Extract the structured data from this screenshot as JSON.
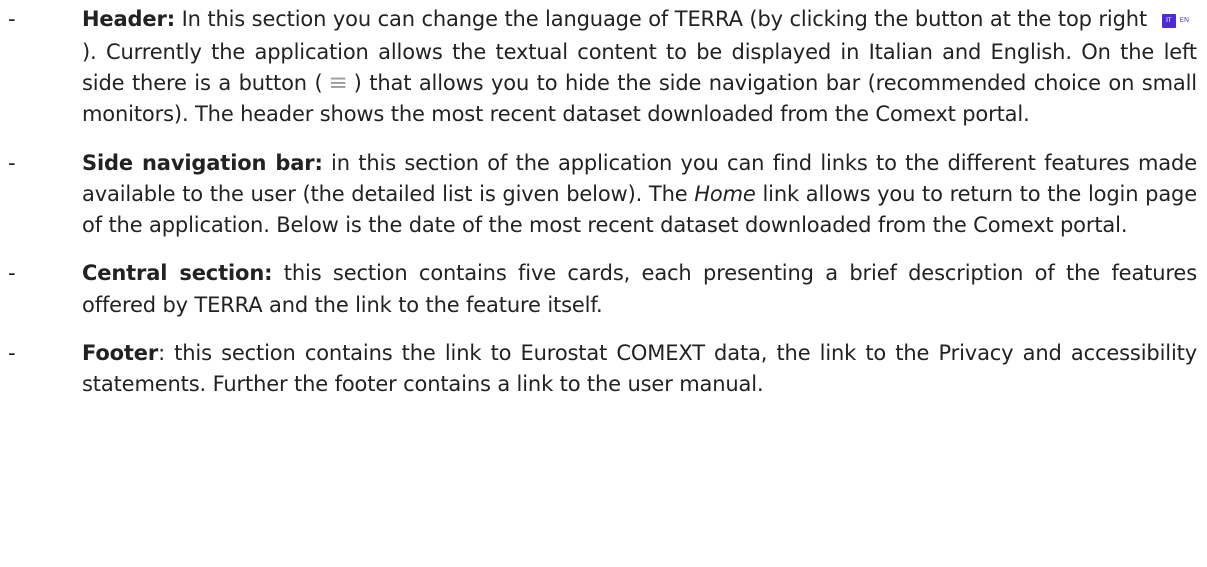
{
  "list": {
    "bullet": "-",
    "items": [
      {
        "heading": "Header:",
        "text_a": " In this section you can change the language of TERRA (by clicking the button at the top right",
        "lang_it": "IT",
        "lang_en": "EN",
        "text_b": "). Currently the application allows the textual content to be displayed in Italian and English. On the left side there is a button (",
        "menu_glyph": "≡",
        "text_c": ") that allows you to hide the side navigation bar (recommended choice on small monitors). The header shows the most recent dataset downloaded from the Comext portal."
      },
      {
        "heading": "Side navigation bar:",
        "text_a": " in this section of the application you can find links to the different features made available to the user (the detailed list is given below). The ",
        "em": "Home",
        "text_b": " link allows you to return to the login page of the application. Below is the date of the most recent dataset downloaded from the Comext portal."
      },
      {
        "heading": "Central section:",
        "text_a": " this section contains five cards, each presenting a brief description of the features offered by TERRA and the link to the feature itself."
      },
      {
        "heading": "Footer",
        "text_a": ": this section contains the link to Eurostat COMEXT data, the link to the Privacy and accessibility statements. Further the footer contains a link to the user manual."
      }
    ]
  },
  "colors": {
    "text": "#222222",
    "lang_badge": "#4f2bd6",
    "lang_en_text": "#5b5bb8",
    "menu_icon": "#9a9a9a"
  },
  "icons": {
    "lang": "language-toggle-icon",
    "menu": "hamburger-menu-icon"
  }
}
